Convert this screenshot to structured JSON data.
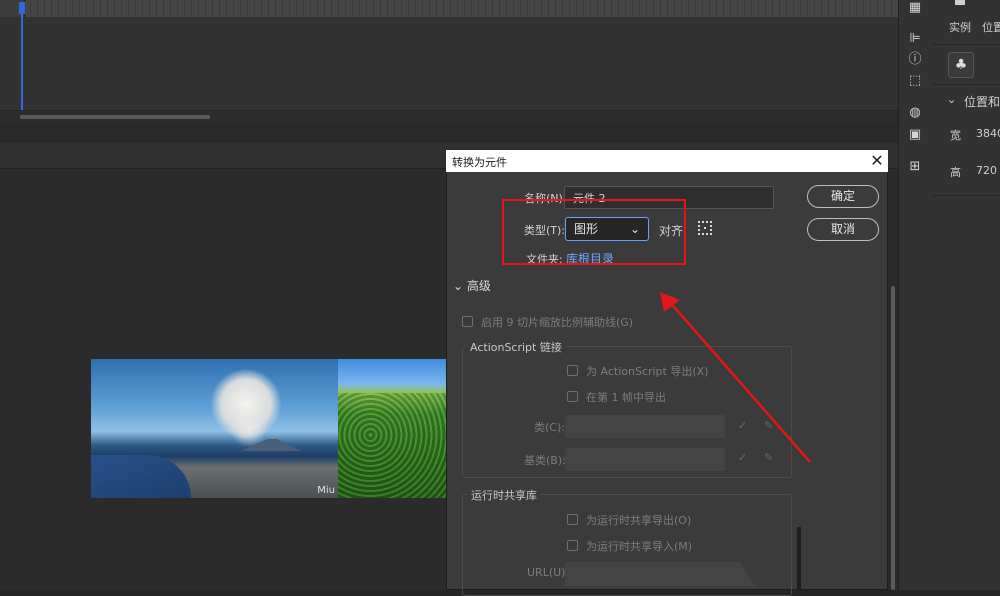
{
  "dialog": {
    "title": "转换为元件",
    "close_glyph": "✕",
    "name_label": "名称(N):",
    "name_value": "元件 2",
    "type_label": "类型(T):",
    "type_value": "图形",
    "align_label": "对齐:",
    "folder_label": "文件夹:",
    "folder_link": "库根目录",
    "ok_label": "确定",
    "cancel_label": "取消",
    "advanced_label": "高级",
    "nine_slice_label": "启用 9 切片缩放比例辅助线(G)",
    "actionscript": {
      "group_title": "ActionScript 链接",
      "export_label": "为 ActionScript 导出(X)",
      "export_frame1_label": "在第 1 帧中导出",
      "class_label": "类(C):",
      "base_class_label": "基类(B):"
    },
    "runtime": {
      "group_title": "运行时共享库",
      "export_label": "为运行时共享导出(O)",
      "import_label": "为运行时共享导入(M)",
      "url_label": "URL(U):"
    }
  },
  "properties": {
    "instance_label": "实例",
    "position_label": "位置",
    "section_label": "位置和",
    "width_label": "宽",
    "width_value": "3840",
    "height_label": "高",
    "height_value": "720"
  },
  "stage": {
    "watermark": "Miu"
  },
  "colors": {
    "highlight": "#e01818",
    "accent": "#2e6bd8",
    "link": "#6fa8ff"
  },
  "icons": [
    "align-icon",
    "info-icon",
    "transform-icon",
    "color-palette-icon",
    "library-icon",
    "components-icon",
    "symbol-icon"
  ]
}
